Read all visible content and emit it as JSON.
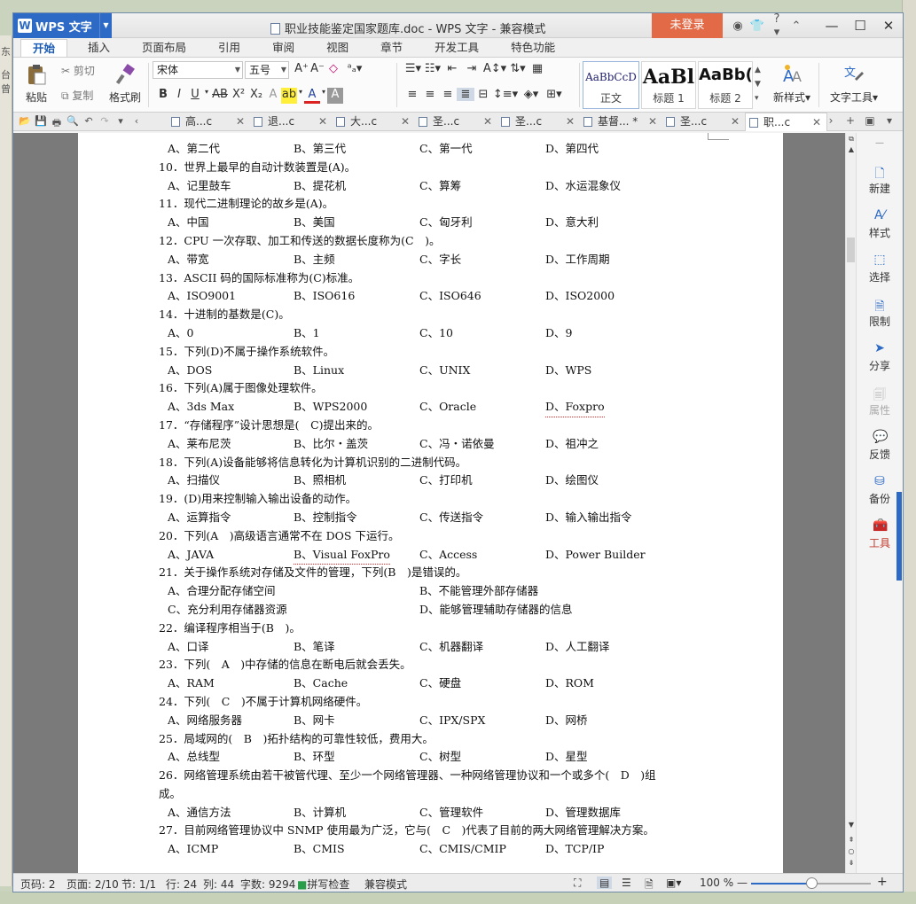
{
  "desktop": {
    "left_labels": [
      "东",
      "台曾"
    ]
  },
  "titlebar": {
    "app_name": "WPS 文字",
    "doc_title": "职业技能鉴定国家题库.doc - WPS 文字 - 兼容模式",
    "login_label": "未登录",
    "help_label": "?"
  },
  "menu": [
    "开始",
    "插入",
    "页面布局",
    "引用",
    "审阅",
    "视图",
    "章节",
    "开发工具",
    "特色功能"
  ],
  "ribbon": {
    "paste": "粘贴",
    "cut": "剪切",
    "copy": "复制",
    "format_painter": "格式刷",
    "font_name": "宋体",
    "font_size": "五号",
    "styles": [
      {
        "sample": "AaBbCcD",
        "label": "正文"
      },
      {
        "sample": "AaBl",
        "label": "标题 1"
      },
      {
        "sample": "AaBb(",
        "label": "标题 2"
      }
    ],
    "new_style": "新样式",
    "text_tools": "文字工具"
  },
  "doc_tabs": [
    {
      "label": "高...c",
      "active": false
    },
    {
      "label": "退...c",
      "active": false
    },
    {
      "label": "大...c",
      "active": false
    },
    {
      "label": "圣...c",
      "active": false
    },
    {
      "label": "圣...c",
      "active": false
    },
    {
      "label": "基督... *",
      "active": false
    },
    {
      "label": "圣...c",
      "active": false
    },
    {
      "label": "职...c",
      "active": true
    }
  ],
  "document": {
    "lines": [
      {
        "type": "o",
        "opts": [
          "A、第二代",
          "B、第三代",
          "C、第一代",
          "D、第四代"
        ]
      },
      {
        "type": "q",
        "text": "10．世界上最早的自动计数装置是(A)。"
      },
      {
        "type": "o",
        "opts": [
          "A、记里鼓车",
          "B、提花机",
          "C、算筹",
          "D、水运混象仪"
        ]
      },
      {
        "type": "q",
        "text": "11．现代二进制理论的故乡是(A)。"
      },
      {
        "type": "o",
        "opts": [
          "A、中国",
          "B、美国",
          "C、匈牙利",
          "D、意大利"
        ]
      },
      {
        "type": "q",
        "text": "12．CPU 一次存取、加工和传送的数据长度称为(C　)。"
      },
      {
        "type": "o",
        "opts": [
          "A、带宽",
          "B、主频",
          "C、字长",
          "D、工作周期"
        ]
      },
      {
        "type": "q",
        "text": "13．ASCII 码的国际标准称为(C)标准。"
      },
      {
        "type": "o",
        "opts": [
          "A、ISO9001",
          "B、ISO616",
          "C、ISO646",
          "D、ISO2000"
        ]
      },
      {
        "type": "q",
        "text": "14．十进制的基数是(C)。"
      },
      {
        "type": "o",
        "opts": [
          "A、0",
          "B、1",
          "C、10",
          "D、9"
        ]
      },
      {
        "type": "q",
        "text": "15．下列(D)不属于操作系统软件。"
      },
      {
        "type": "o",
        "opts": [
          "A、DOS",
          "B、Linux",
          "C、UNIX",
          "D、WPS"
        ]
      },
      {
        "type": "q",
        "text": "16．下列(A)属于图像处理软件。"
      },
      {
        "type": "o",
        "opts": [
          "A、3ds Max",
          "B、WPS2000",
          "C、Oracle",
          "D、Foxpro"
        ]
      },
      {
        "type": "q",
        "text": "17．“存储程序”设计思想是(　C)提出来的。"
      },
      {
        "type": "o",
        "opts": [
          "A、莱布尼茨",
          "B、比尔・盖茨",
          "C、冯・诺依曼",
          "D、祖冲之"
        ]
      },
      {
        "type": "q",
        "text": "18．下列(A)设备能够将信息转化为计算机识别的二进制代码。"
      },
      {
        "type": "o",
        "opts": [
          "A、扫描仪",
          "B、照相机",
          "C、打印机",
          "D、绘图仪"
        ]
      },
      {
        "type": "q",
        "text": "19．(D)用来控制输入输出设备的动作。"
      },
      {
        "type": "o",
        "opts": [
          "A、运算指令",
          "B、控制指令",
          "C、传送指令",
          "D、输入输出指令"
        ]
      },
      {
        "type": "q",
        "text": "20．下列(A　)高级语言通常不在 DOS 下运行。"
      },
      {
        "type": "o",
        "opts": [
          "A、JAVA",
          "B、Visual FoxPro",
          "C、Access",
          "D、Power Builder"
        ]
      },
      {
        "type": "q",
        "text": "21．关于操作系统对存储及文件的管理，下列(B　)是错误的。"
      },
      {
        "type": "o2",
        "opts": [
          "A、合理分配存储空间",
          "B、不能管理外部存储器"
        ]
      },
      {
        "type": "o2",
        "opts": [
          "C、充分利用存储器资源",
          "D、能够管理辅助存储器的信息"
        ]
      },
      {
        "type": "q",
        "text": "22．编译程序相当于(B　)。"
      },
      {
        "type": "o",
        "opts": [
          "A、口译",
          "B、笔译",
          "C、机器翻译",
          "D、人工翻译"
        ]
      },
      {
        "type": "q",
        "text": "23．下列(　A　)中存储的信息在断电后就会丢失。"
      },
      {
        "type": "o",
        "opts": [
          "A、RAM",
          "B、Cache",
          "C、硬盘",
          "D、ROM"
        ]
      },
      {
        "type": "q",
        "text": "24．下列(　C　)不属于计算机网络硬件。"
      },
      {
        "type": "o",
        "opts": [
          "A、网络服务器",
          "B、网卡",
          "C、IPX/SPX",
          "D、网桥"
        ]
      },
      {
        "type": "q",
        "text": "25．局域网的(　B　)拓扑结构的可靠性较低，费用大。"
      },
      {
        "type": "o",
        "opts": [
          "A、总线型",
          "B、环型",
          "C、树型",
          "D、星型"
        ]
      },
      {
        "type": "q",
        "text": "26．网络管理系统由若干被管代理、至少一个网络管理器、一种网络管理协议和一个或多个(　D　)组"
      },
      {
        "type": "q",
        "text": "成。"
      },
      {
        "type": "o",
        "opts": [
          "A、通信方法",
          "B、计算机",
          "C、管理软件",
          "D、管理数据库"
        ]
      },
      {
        "type": "q",
        "text": "27．目前网络管理协议中 SNMP 使用最为广泛，它与(　C　)代表了目前的两大网络管理解决方案。"
      },
      {
        "type": "o",
        "opts": [
          "A、ICMP",
          "B、CMIS",
          "C、CMIS/CMIP",
          "D、TCP/IP"
        ]
      }
    ]
  },
  "sidepanel": [
    {
      "label": "新建",
      "icon": "new-doc-icon",
      "state": "normal"
    },
    {
      "label": "样式",
      "icon": "style-icon",
      "state": "normal"
    },
    {
      "label": "选择",
      "icon": "select-icon",
      "state": "normal"
    },
    {
      "label": "限制",
      "icon": "restrict-icon",
      "state": "normal"
    },
    {
      "label": "分享",
      "icon": "share-icon",
      "state": "normal"
    },
    {
      "label": "属性",
      "icon": "properties-icon",
      "state": "disabled"
    },
    {
      "label": "反馈",
      "icon": "feedback-icon",
      "state": "normal"
    },
    {
      "label": "备份",
      "icon": "backup-icon",
      "state": "normal"
    },
    {
      "label": "工具",
      "icon": "toolbox-icon",
      "state": "red"
    }
  ],
  "status": {
    "page": "页码: 2",
    "pages": "页面: 2/10",
    "section": "节: 1/1",
    "row": "行: 24",
    "col": "列: 44",
    "wordcount": "字数: 9294",
    "spell": "拼写检查",
    "compat": "兼容模式",
    "zoom": "100 %",
    "zoom_level": 0.5
  },
  "colors": {
    "accent": "#2d6ac5",
    "login": "#e26a47"
  }
}
